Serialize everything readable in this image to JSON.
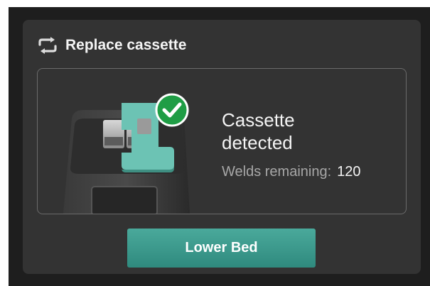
{
  "dialog": {
    "title": "Replace cassette",
    "icon": "swap-arrows-icon"
  },
  "status": {
    "title": "Cassette detected",
    "welds_label": "Welds remaining:",
    "welds_value": "120",
    "check_icon": "checkmark-icon"
  },
  "actions": {
    "primary_label": "Lower Bed"
  },
  "colors": {
    "background": "#1e1e1e",
    "panel": "#333333",
    "accent": "#3d9c8f",
    "cassette": "#6cc3b4",
    "check": "#1f9d45"
  }
}
